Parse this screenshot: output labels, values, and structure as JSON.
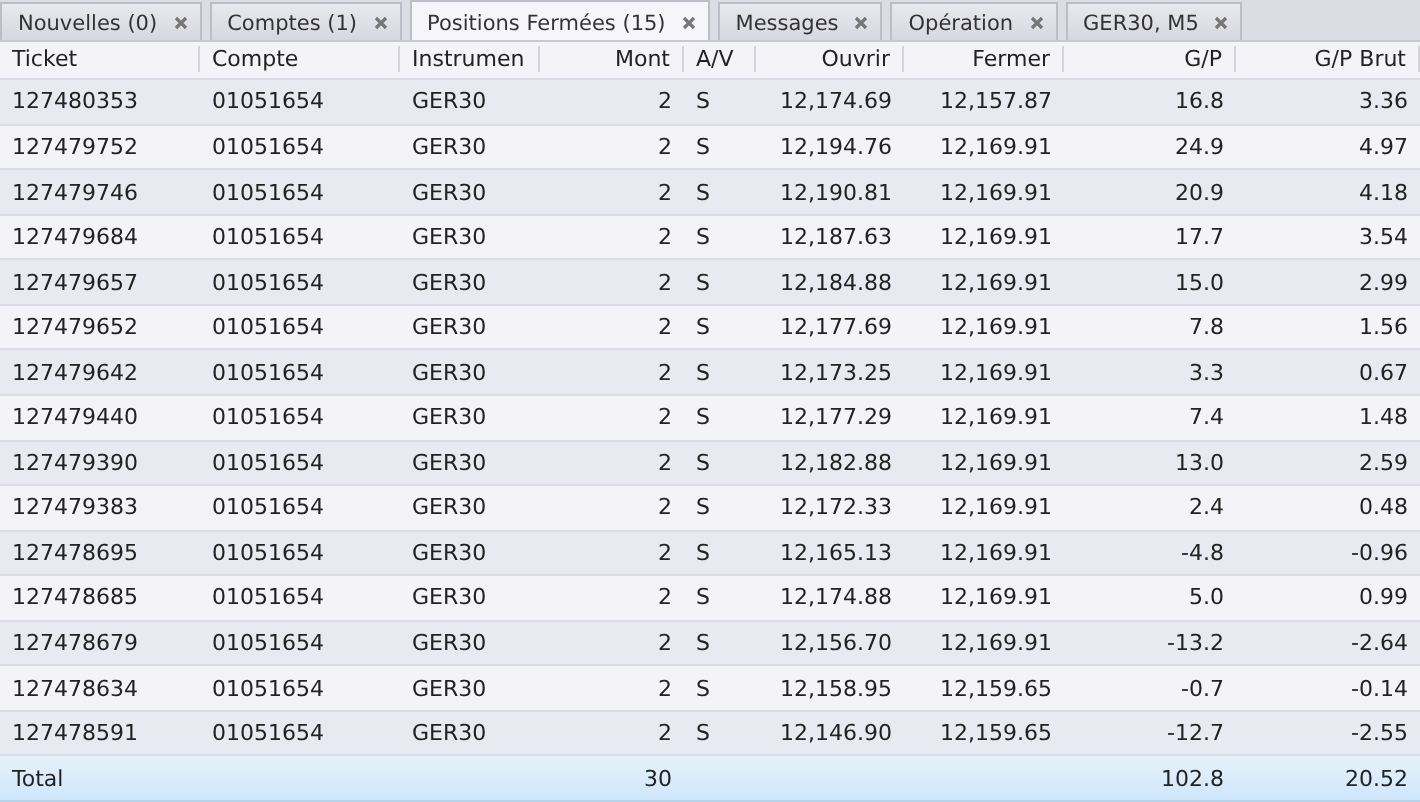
{
  "tabs": [
    {
      "label": "Nouvelles (0)",
      "selected": false
    },
    {
      "label": "Comptes (1)",
      "selected": false
    },
    {
      "label": "Positions Fermées (15)",
      "selected": true
    },
    {
      "label": "Messages",
      "selected": false
    },
    {
      "label": "Opération",
      "selected": false
    },
    {
      "label": "GER30, M5",
      "selected": false
    }
  ],
  "table": {
    "columns": [
      "Ticket",
      "Compte",
      "Instrumen",
      "Mont",
      "A/V",
      "Ouvrir",
      "Fermer",
      "G/P",
      "G/P Brut"
    ],
    "rows": [
      [
        "127480353",
        "01051654",
        "GER30",
        "2",
        "S",
        "12,174.69",
        "12,157.87",
        "16.8",
        "3.36"
      ],
      [
        "127479752",
        "01051654",
        "GER30",
        "2",
        "S",
        "12,194.76",
        "12,169.91",
        "24.9",
        "4.97"
      ],
      [
        "127479746",
        "01051654",
        "GER30",
        "2",
        "S",
        "12,190.81",
        "12,169.91",
        "20.9",
        "4.18"
      ],
      [
        "127479684",
        "01051654",
        "GER30",
        "2",
        "S",
        "12,187.63",
        "12,169.91",
        "17.7",
        "3.54"
      ],
      [
        "127479657",
        "01051654",
        "GER30",
        "2",
        "S",
        "12,184.88",
        "12,169.91",
        "15.0",
        "2.99"
      ],
      [
        "127479652",
        "01051654",
        "GER30",
        "2",
        "S",
        "12,177.69",
        "12,169.91",
        "7.8",
        "1.56"
      ],
      [
        "127479642",
        "01051654",
        "GER30",
        "2",
        "S",
        "12,173.25",
        "12,169.91",
        "3.3",
        "0.67"
      ],
      [
        "127479440",
        "01051654",
        "GER30",
        "2",
        "S",
        "12,177.29",
        "12,169.91",
        "7.4",
        "1.48"
      ],
      [
        "127479390",
        "01051654",
        "GER30",
        "2",
        "S",
        "12,182.88",
        "12,169.91",
        "13.0",
        "2.59"
      ],
      [
        "127479383",
        "01051654",
        "GER30",
        "2",
        "S",
        "12,172.33",
        "12,169.91",
        "2.4",
        "0.48"
      ],
      [
        "127478695",
        "01051654",
        "GER30",
        "2",
        "S",
        "12,165.13",
        "12,169.91",
        "-4.8",
        "-0.96"
      ],
      [
        "127478685",
        "01051654",
        "GER30",
        "2",
        "S",
        "12,174.88",
        "12,169.91",
        "5.0",
        "0.99"
      ],
      [
        "127478679",
        "01051654",
        "GER30",
        "2",
        "S",
        "12,156.70",
        "12,169.91",
        "-13.2",
        "-2.64"
      ],
      [
        "127478634",
        "01051654",
        "GER30",
        "2",
        "S",
        "12,158.95",
        "12,159.65",
        "-0.7",
        "-0.14"
      ],
      [
        "127478591",
        "01051654",
        "GER30",
        "2",
        "S",
        "12,146.90",
        "12,159.65",
        "-12.7",
        "-2.55"
      ]
    ],
    "total": {
      "label": "Total",
      "mont": "30",
      "gp": "102.8",
      "gp_brut": "20.52"
    }
  }
}
